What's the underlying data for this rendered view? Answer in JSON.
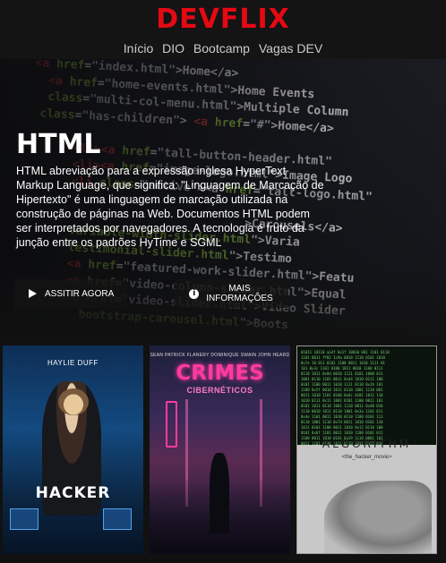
{
  "header": {
    "logo": "DEVFLIX",
    "nav": [
      "Início",
      "DIO",
      "Bootcamp",
      "Vagas DEV"
    ]
  },
  "hero": {
    "title": "HTML",
    "description": "HTML abreviação para a expressão inglesa HyperText Markup Language, que significa: \"Linguagem de Marcação de Hipertexto\" é uma linguagem de marcação utilizada na construção de páginas na Web. Documentos HTML podem ser interpretados por navegadores. A tecnologia é fruto da junção entre os padrões HyTime e SGML",
    "play_label": "ASSITIR AGORA",
    "info_label_1": "MAIS",
    "info_label_2": "INFORMAÇÕES",
    "play_icon": "play-icon",
    "info_icon": "info-icon"
  },
  "posters": {
    "hacker": {
      "actor": "HAYLIE DUFF",
      "title": "HACKER"
    },
    "crimes": {
      "credits": "SEAN PATRICK FLANERY   DOMINIQUE SWAIN   JOHN HEARD",
      "title": "CRIMES",
      "subtitle": "CIBERNÉTICOS"
    },
    "algorithm": {
      "title": "ALGORITHM",
      "subtitle": "<the_hacker_movie>"
    }
  },
  "colors": {
    "brand": "#e50914",
    "background": "#111111"
  }
}
